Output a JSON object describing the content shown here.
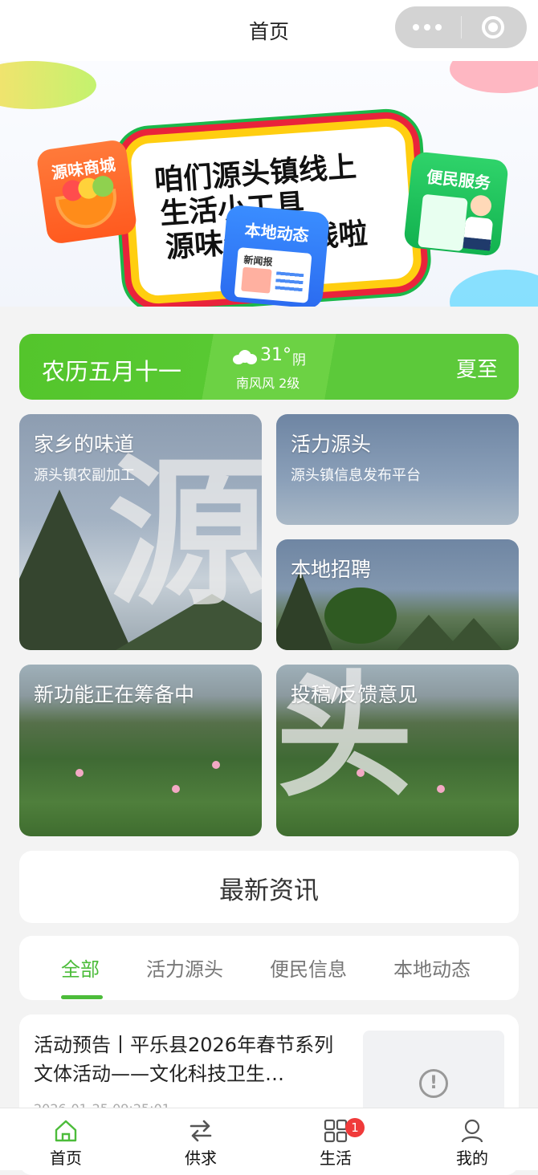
{
  "nav": {
    "title": "首页"
  },
  "banner": {
    "headline_1": "咱们源头镇线上",
    "headline_2": "生活小工具",
    "headline_3": "源味生活上线啦",
    "card_mall": "源味商城",
    "card_local": "本地动态",
    "card_local_paper": "新闻报",
    "card_service": "便民服务"
  },
  "weather": {
    "lunar_date": "农历五月十一",
    "temperature": "31°",
    "condition": "阴",
    "wind": "南风风 2级",
    "solar_term": "夏至",
    "icon": "cloud-icon"
  },
  "tiles": {
    "hometown": {
      "title": "家乡的味道",
      "subtitle": "源头镇农副加工",
      "big_char": "源"
    },
    "vitality": {
      "title": "活力源头",
      "subtitle": "源头镇信息发布平台"
    },
    "jobs": {
      "title": "本地招聘"
    },
    "new_feature": {
      "title": "新功能正在筹备中"
    },
    "feedback": {
      "title": "投稿/反馈意见",
      "big_char": "头"
    }
  },
  "news": {
    "header": "最新资讯",
    "tabs": [
      "全部",
      "活力源头",
      "便民信息",
      "本地动态"
    ],
    "active_tab": 0,
    "articles": [
      {
        "title": "活动预告丨平乐县2026年春节系列文体活动——文化科技卫生…",
        "meta": "2026-01-25 09:25:01"
      }
    ]
  },
  "tabbar": {
    "items": [
      {
        "label": "首页",
        "icon": "home-icon"
      },
      {
        "label": "供求",
        "icon": "swap-icon"
      },
      {
        "label": "生活",
        "icon": "grid-icon",
        "badge": "1"
      },
      {
        "label": "我的",
        "icon": "user-icon"
      }
    ]
  },
  "colors": {
    "accent": "#4cbc3a",
    "weather_bg": "#5cc93a",
    "badge": "#f03a3a"
  }
}
